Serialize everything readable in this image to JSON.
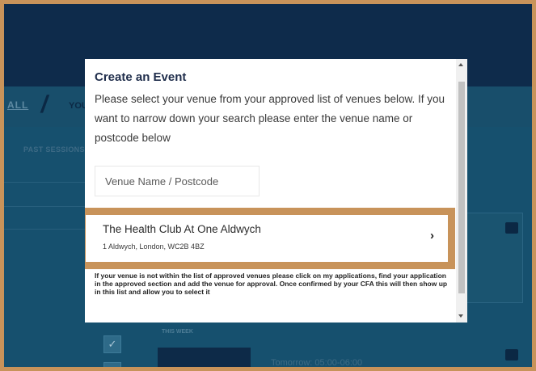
{
  "background": {
    "tab_all_label": "ALL",
    "tab_you_label": "YOU",
    "past_sessions_label": "PAST SESSIONS",
    "this_week_label": "THIS WEEK",
    "tomorrow_label": "Tomorrow: 05:00-06:00"
  },
  "modal": {
    "title": "Create an Event",
    "description": "Please select your venue from your approved list of venues below. If you want to narrow down your search please enter the venue name or postcode below",
    "search": {
      "placeholder": "Venue Name / Postcode",
      "value": ""
    },
    "venues": [
      {
        "name": "The Health Club At One Aldwych",
        "address": "1 Aldwych, London, WC2B 4BZ",
        "chevron": "›"
      }
    ],
    "help_text": "If your venue is not within the list of approved venues please click on my applications, find your application in the approved section and add the venue for approval. Once confirmed by your CFA this will then show up in this list and allow you to select it"
  },
  "colors": {
    "highlight": "#c8935a",
    "header": "#0e2b4b",
    "page": "#16506e"
  }
}
